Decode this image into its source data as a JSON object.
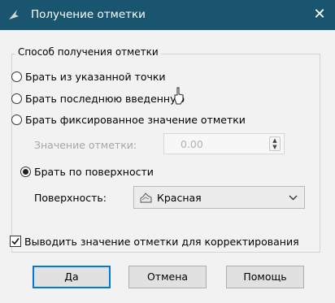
{
  "window": {
    "title": "Получение отметки",
    "close_glyph": "✕"
  },
  "group": {
    "legend": "Способ получения отметки"
  },
  "options": {
    "from_point": "Брать из указанной точки",
    "last_entered": "Брать последнюю введенную",
    "fixed_value": "Брать фиксированное значение отметки",
    "from_surface": "Брать по поверхности",
    "selected": "from_surface"
  },
  "elevation": {
    "label": "Значение отметки:",
    "value": "0.00"
  },
  "surface": {
    "label": "Поверхность:",
    "selected": "Красная",
    "icon": "surface-icon"
  },
  "correction": {
    "label": "Выводить значение отметки для корректирования",
    "checked": true
  },
  "buttons": {
    "ok": "Да",
    "cancel": "Отмена",
    "help": "Помощь"
  },
  "colors": {
    "titlebar": "#1a556f",
    "client": "#f2f2f2",
    "focus": "#0078d7"
  }
}
